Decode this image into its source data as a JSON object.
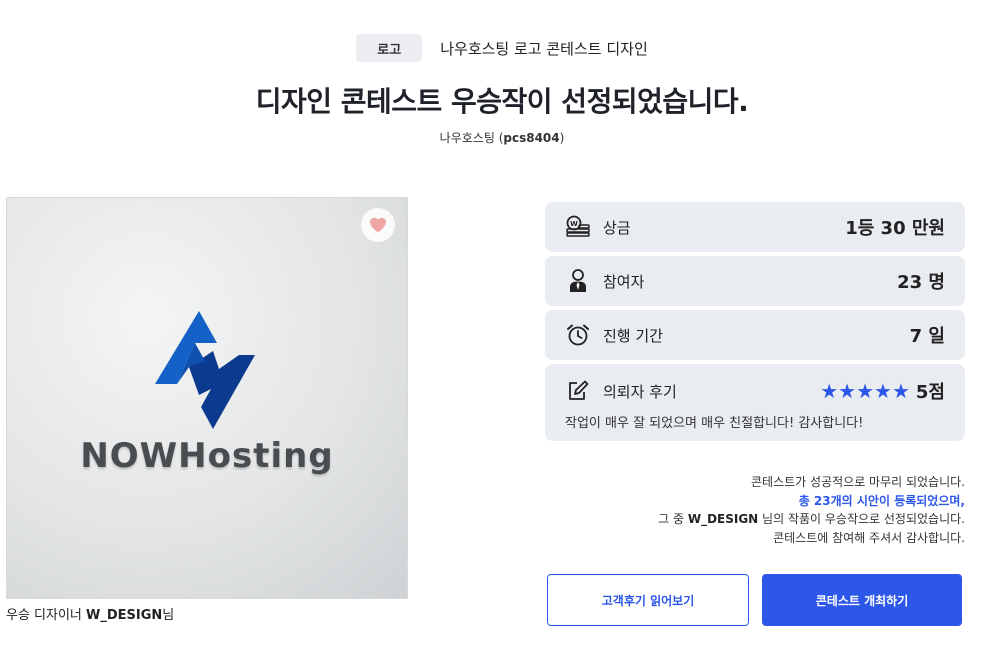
{
  "header": {
    "category_badge": "로고",
    "contest_name": "나우호스팅 로고 콘테스트 디자인",
    "headline": "디자인 콘테스트 우승작이 선정되었습니다.",
    "host_name": "나우호스팅",
    "host_id": "pcs8404"
  },
  "winner": {
    "logo_text": "NOWHosting",
    "caption_prefix": "우승 디자이너 ",
    "designer": "W_DESIGN",
    "caption_suffix": "님",
    "icons": {
      "favorite": "heart-icon"
    }
  },
  "info": {
    "prize": {
      "label": "상금",
      "value": "1등 30 만원",
      "icon": "prize-money-icon"
    },
    "participants": {
      "label": "참여자",
      "value": "23 명",
      "icon": "person-icon"
    },
    "period": {
      "label": "진행 기간",
      "value": "7 일",
      "icon": "alarm-clock-icon"
    },
    "review": {
      "label": "의뢰자 후기",
      "stars": "★★★★★",
      "rating": 5,
      "score": "5점",
      "text": "작업이 매우 잘 되었으며 매우 친절합니다! 감사합니다!",
      "icon": "edit-icon"
    }
  },
  "message": {
    "line1": "콘테스트가 성공적으로 마무리 되었습니다.",
    "line2": "총 23개의 시안이 등록되었으며,",
    "line3_prefix": "그 중 ",
    "line3_designer": "W_DESIGN",
    "line3_suffix": " 님의 작품이 우승작으로 선정되었습니다.",
    "line4": "콘테스트에 참여해 주셔서 감사합니다."
  },
  "buttons": {
    "read_reviews": "고객후기 읽어보기",
    "host_contest": "콘테스트 개최하기"
  },
  "colors": {
    "accent": "#2c57e8",
    "card_bg": "#e9ecf0",
    "logo_blue_dark": "#0b3a8e",
    "logo_blue_light": "#1461c8"
  }
}
